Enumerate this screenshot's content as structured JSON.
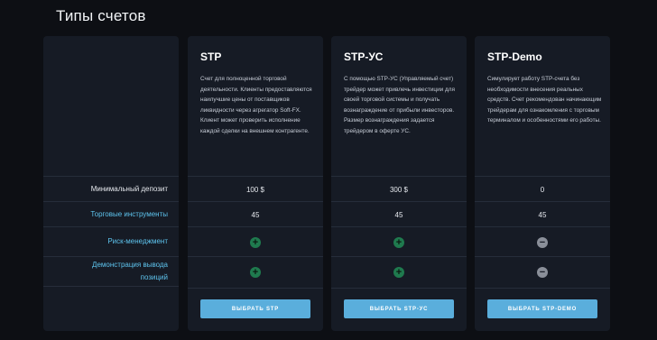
{
  "page": {
    "title": "Типы счетов"
  },
  "labels": [
    {
      "text": "Минимальный депозит",
      "style": "plain"
    },
    {
      "text": "Торговые инструменты",
      "style": "link"
    },
    {
      "text": "Риск-менеджмент",
      "style": "link"
    },
    {
      "text": "Демонстрация вывода позиций",
      "style": "link"
    }
  ],
  "plans": [
    {
      "name": "STP",
      "description": "Счет для полноценной торговой деятельности. Клиенты предоставляются наилучшие цены от поставщиков ликвидности через агрегатор Soft-FX. Клиент может проверить исполнение каждой сделки на внешнем контрагенте.",
      "min_deposit": "100 $",
      "instruments": "45",
      "risk_management": "plus-icon",
      "withdrawal_demo": "plus-icon",
      "button": "ВЫБРАТЬ STP"
    },
    {
      "name": "STP-УС",
      "description": "С помощью STP-УС (Управляемый счет) трейдер может привлечь инвестиции для своей торговой системы и получать вознаграждение от прибыли инвесторов. Размер вознаграждения задается трейдером в оферте УС.",
      "min_deposit": "300 $",
      "instruments": "45",
      "risk_management": "plus-icon",
      "withdrawal_demo": "plus-icon",
      "button": "ВЫБРАТЬ STP-УС"
    },
    {
      "name": "STP-Demo",
      "description": "Симулирует работу STP-счета без необходимости внесения реальных средств. Счет рекомендован начинающим трейдерам для ознакомления с торговым терминалом и особенностями его работы.",
      "min_deposit": "0",
      "instruments": "45",
      "risk_management": "minus-icon",
      "withdrawal_demo": "minus-icon",
      "button": "ВЫБРАТЬ STP-DEMO"
    }
  ],
  "colors": {
    "background": "#0d0f14",
    "panel": "#161b25",
    "link": "#5ec4ee",
    "button": "#5aaedc",
    "plus": "#1f7a4e",
    "minus": "#8a8f99"
  }
}
